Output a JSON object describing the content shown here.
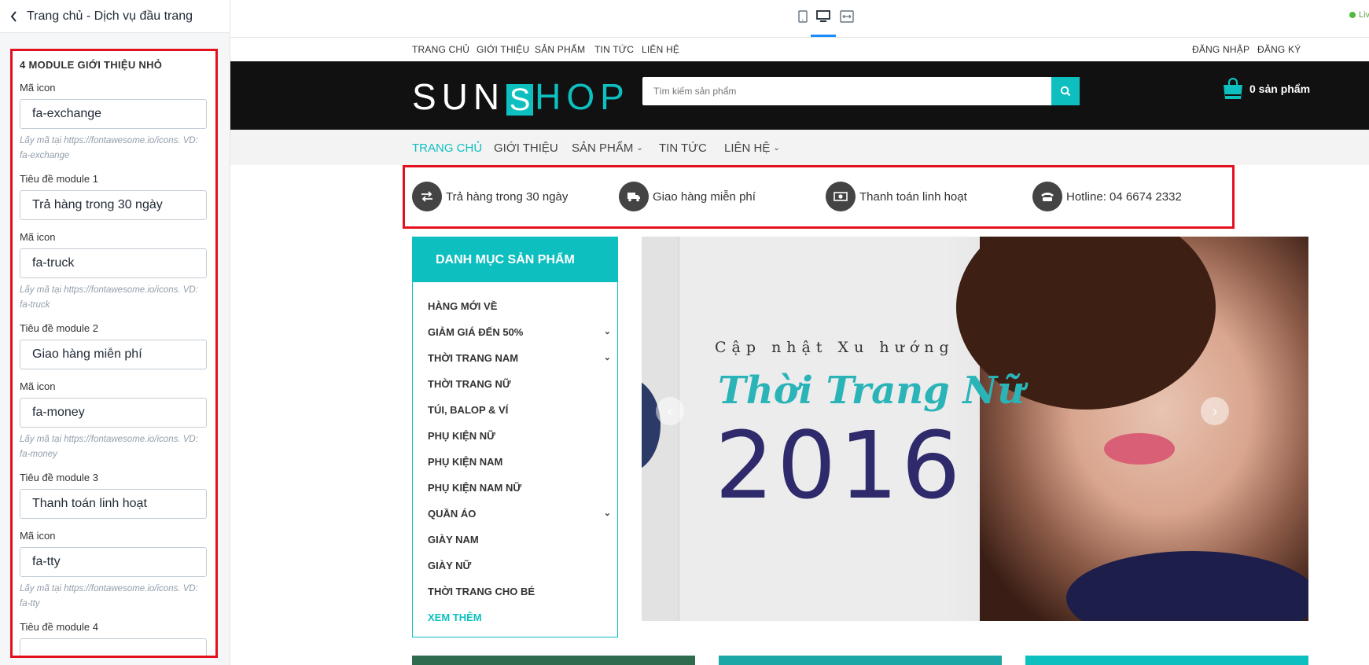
{
  "editor": {
    "title": "Trang chủ - Dịch vụ đầu trang",
    "panel_heading": "4 MODULE GIỚI THIỆU NHỎ",
    "fields": [
      {
        "label": "Mã icon",
        "value": "fa-exchange",
        "help": "Lấy mã tại https://fontawesome.io/icons. VD: fa-exchange"
      },
      {
        "label": "Tiêu đề module 1",
        "value": "Trả hàng trong 30 ngày"
      },
      {
        "label": "Mã icon",
        "value": "fa-truck",
        "help": "Lấy mã tại https://fontawesome.io/icons. VD: fa-truck"
      },
      {
        "label": "Tiêu đề module 2",
        "value": "Giao hàng miễn phí"
      },
      {
        "label": "Mã icon",
        "value": "fa-money",
        "help": "Lấy mã tại https://fontawesome.io/icons. VD: fa-money"
      },
      {
        "label": "Tiêu đề module 3",
        "value": "Thanh toán linh hoạt"
      },
      {
        "label": "Mã icon",
        "value": "fa-tty",
        "help": "Lấy mã tại https://fontawesome.io/icons. VD: fa-tty"
      },
      {
        "label": "Tiêu đề module 4",
        "value": ""
      }
    ]
  },
  "toolbar": {
    "devices": [
      "mobile-icon",
      "desktop-icon",
      "fullwidth-icon"
    ],
    "active_device": "desktop",
    "live_label": "Live",
    "accent": "#1a8cff"
  },
  "store": {
    "topnav_left": [
      "TRANG CHỦ",
      "GIỚI THIỆU",
      "SẢN PHẨM",
      "TIN TỨC",
      "LIÊN HỆ"
    ],
    "topnav_right": [
      "ĐĂNG NHẬP",
      "ĐĂNG KÝ"
    ],
    "logo": {
      "part1": "SUN",
      "part2": "S",
      "part3": "HOP"
    },
    "search_placeholder": "Tìm kiếm sản phẩm",
    "cart_label": "0 sản phẩm",
    "brand_color": "#0ebfc0",
    "main_nav": [
      {
        "label": "TRANG CHỦ",
        "active": true,
        "dropdown": false
      },
      {
        "label": "GIỚI THIỆU",
        "active": false,
        "dropdown": false
      },
      {
        "label": "SẢN PHẨM",
        "active": false,
        "dropdown": true
      },
      {
        "label": "TIN TỨC",
        "active": false,
        "dropdown": false
      },
      {
        "label": "LIÊN HỆ",
        "active": false,
        "dropdown": true
      }
    ],
    "features": [
      {
        "icon": "exchange-icon",
        "label": "Trả hàng trong 30 ngày"
      },
      {
        "icon": "truck-icon",
        "label": "Giao hàng miễn phí"
      },
      {
        "icon": "money-icon",
        "label": "Thanh toán linh hoạt"
      },
      {
        "icon": "tty-icon",
        "label": "Hotline: 04 6674 2332"
      }
    ],
    "category_title": "DANH MỤC SẢN PHẨM",
    "categories": [
      {
        "label": "HÀNG MỚI VỀ",
        "sub": false
      },
      {
        "label": "GIẢM GIÁ ĐẾN 50%",
        "sub": true
      },
      {
        "label": "THỜI TRANG NAM",
        "sub": true
      },
      {
        "label": "THỜI TRANG NỮ",
        "sub": false
      },
      {
        "label": "TÚI, BALOP & VÍ",
        "sub": false
      },
      {
        "label": "PHỤ KIỆN NỮ",
        "sub": false
      },
      {
        "label": "PHỤ KIỆN NAM",
        "sub": false
      },
      {
        "label": "PHỤ KIỆN NAM NỮ",
        "sub": false
      },
      {
        "label": "QUẦN ÁO",
        "sub": true
      },
      {
        "label": "GIÀY NAM",
        "sub": false
      },
      {
        "label": "GIÀY NỮ",
        "sub": false
      },
      {
        "label": "THỜI TRANG CHO BÉ",
        "sub": false
      },
      {
        "label": "XEM THÊM",
        "sub": false
      }
    ],
    "slide": {
      "subtitle": "Cập nhật Xu hướng",
      "script": "Thời Trang Nữ",
      "year": "2016"
    }
  }
}
